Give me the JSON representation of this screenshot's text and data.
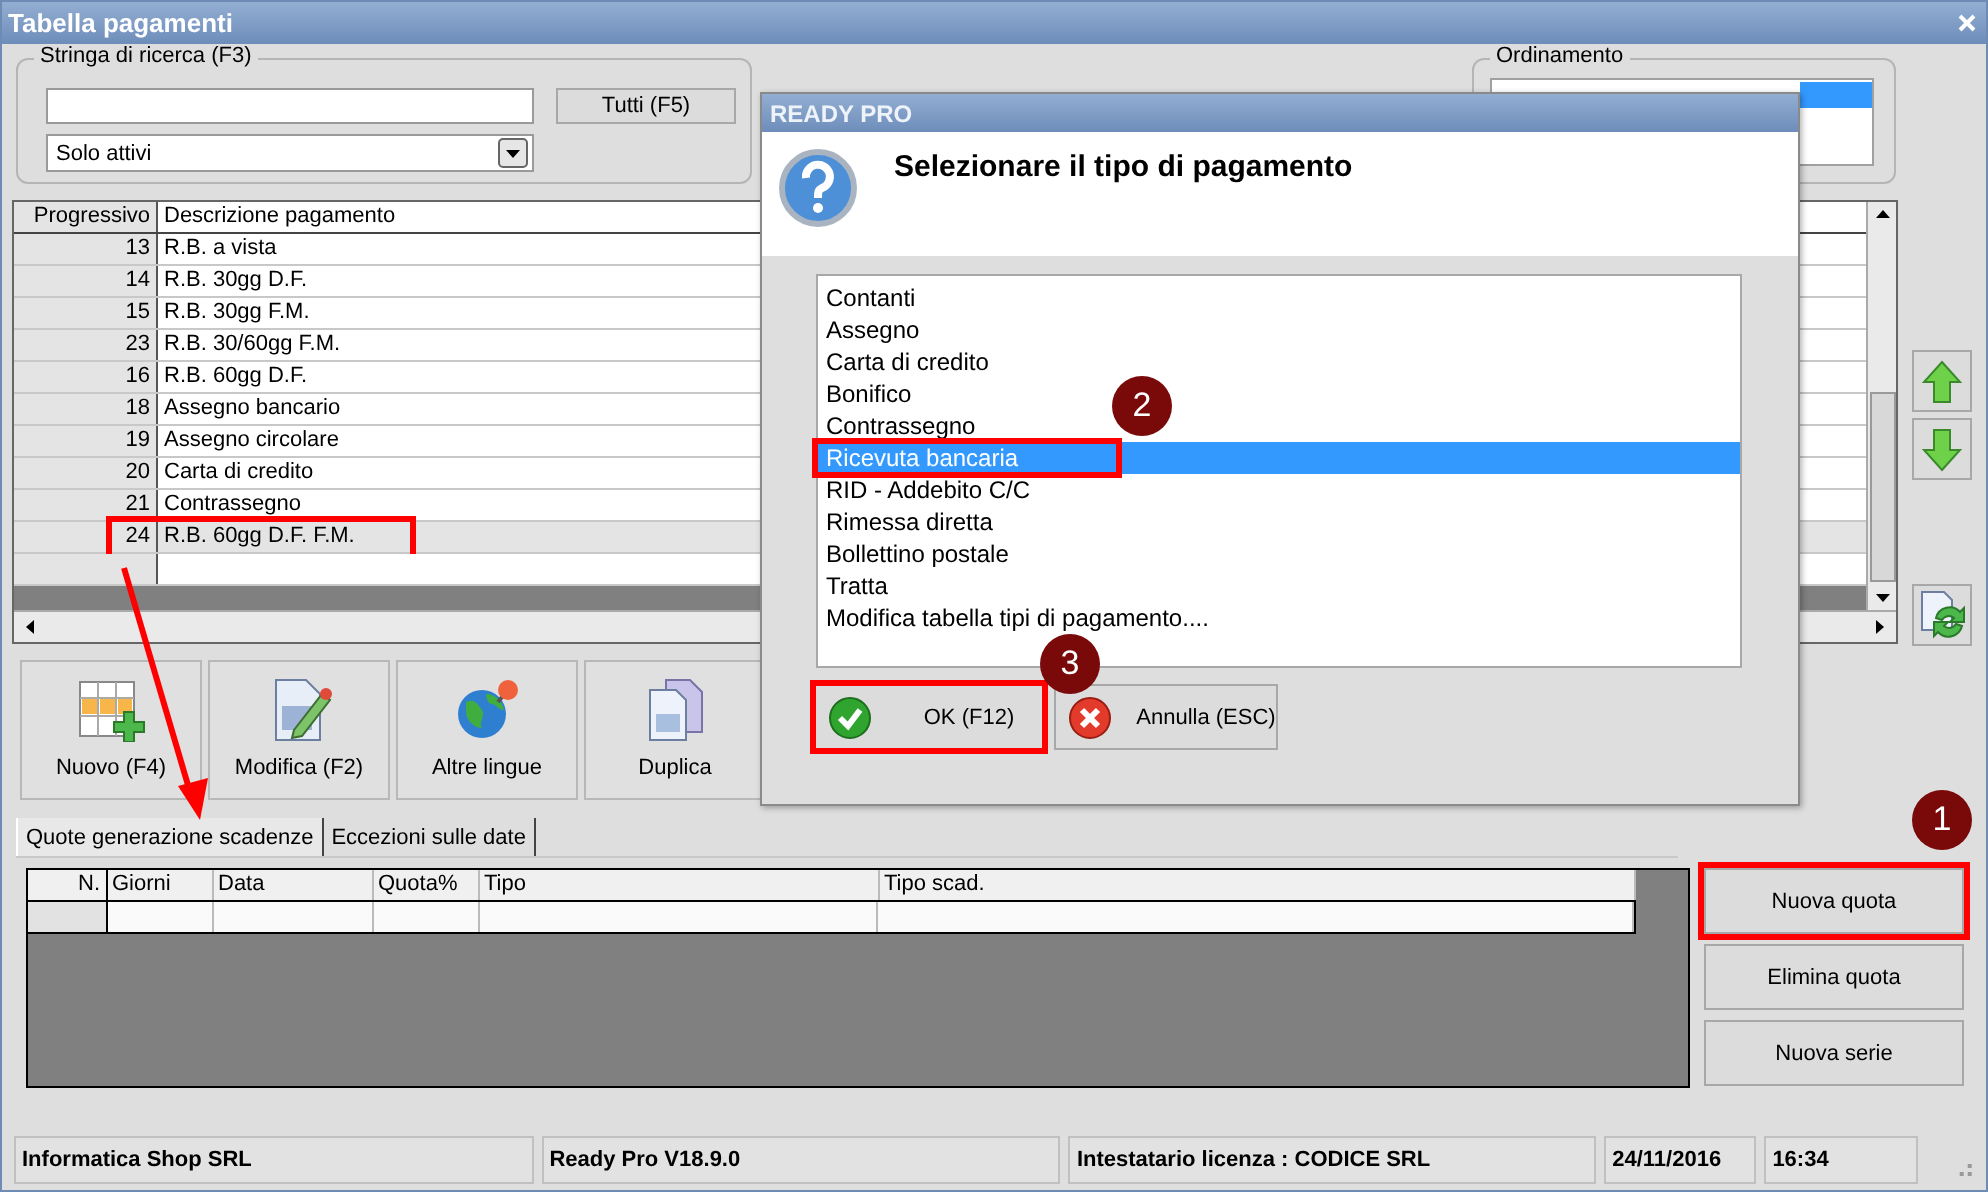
{
  "window": {
    "title": "Tabella pagamenti"
  },
  "search": {
    "legend": "Stringa di ricerca (F3)",
    "all_button": "Tutti (F5)",
    "filter": "Solo attivi"
  },
  "sort": {
    "legend": "Ordinamento"
  },
  "table": {
    "columns": [
      "Progressivo",
      "Descrizione pagamento"
    ],
    "rows": [
      {
        "progressivo": "13",
        "descrizione": "R.B. a vista",
        "selected": false,
        "highlighted": false
      },
      {
        "progressivo": "14",
        "descrizione": "R.B. 30gg D.F.",
        "selected": false,
        "highlighted": false
      },
      {
        "progressivo": "15",
        "descrizione": "R.B. 30gg F.M.",
        "selected": false,
        "highlighted": false
      },
      {
        "progressivo": "23",
        "descrizione": "R.B. 30/60gg F.M.",
        "selected": false,
        "highlighted": false
      },
      {
        "progressivo": "16",
        "descrizione": "R.B. 60gg D.F.",
        "selected": false,
        "highlighted": false
      },
      {
        "progressivo": "18",
        "descrizione": "Assegno bancario",
        "selected": false,
        "highlighted": false
      },
      {
        "progressivo": "19",
        "descrizione": "Assegno circolare",
        "selected": false,
        "highlighted": false
      },
      {
        "progressivo": "20",
        "descrizione": "Carta di credito",
        "selected": false,
        "highlighted": false
      },
      {
        "progressivo": "21",
        "descrizione": "Contrassegno",
        "selected": false,
        "highlighted": false
      },
      {
        "progressivo": "24",
        "descrizione": "R.B. 60gg D.F. F.M.",
        "selected": true,
        "highlighted": true
      }
    ]
  },
  "toolbar": [
    {
      "label": "Nuovo (F4)"
    },
    {
      "label": "Modifica (F2)"
    },
    {
      "label": "Altre lingue"
    },
    {
      "label": "Duplica"
    }
  ],
  "tabs": [
    {
      "label": "Quote generazione scadenze",
      "selected": true
    },
    {
      "label": "Eccezioni sulle date",
      "selected": false
    }
  ],
  "quota_table": {
    "columns": [
      "N.",
      "Giorni",
      "Data",
      "Quota%",
      "Tipo",
      "Tipo scad."
    ]
  },
  "side_buttons": [
    {
      "label": "Nuova quota",
      "highlighted": true
    },
    {
      "label": "Elimina quota",
      "highlighted": false
    },
    {
      "label": "Nuova serie",
      "highlighted": false
    }
  ],
  "status_bar": [
    "Informatica Shop SRL",
    "Ready Pro V18.9.0",
    "Intestatario licenza : CODICE SRL",
    "24/11/2016",
    "16:34"
  ],
  "dialog": {
    "title": "READY PRO",
    "prompt": "Selezionare il tipo di pagamento",
    "options": [
      {
        "label": "Contanti",
        "selected": false,
        "highlighted": false
      },
      {
        "label": "Assegno",
        "selected": false,
        "highlighted": false
      },
      {
        "label": "Carta di credito",
        "selected": false,
        "highlighted": false
      },
      {
        "label": "Bonifico",
        "selected": false,
        "highlighted": false
      },
      {
        "label": "Contrassegno",
        "selected": false,
        "highlighted": false
      },
      {
        "label": "Ricevuta bancaria",
        "selected": true,
        "highlighted": true
      },
      {
        "label": "RID - Addebito C/C",
        "selected": false,
        "highlighted": false
      },
      {
        "label": "Rimessa diretta",
        "selected": false,
        "highlighted": false
      },
      {
        "label": "Bollettino postale",
        "selected": false,
        "highlighted": false
      },
      {
        "label": "Tratta",
        "selected": false,
        "highlighted": false
      },
      {
        "label": "Modifica tabella tipi di pagamento....",
        "selected": false,
        "highlighted": false
      }
    ],
    "buttons": [
      {
        "label": "OK (F12)",
        "highlighted": true
      },
      {
        "label": "Annulla (ESC)",
        "highlighted": false
      }
    ]
  },
  "callouts": [
    {
      "label": "1"
    },
    {
      "label": "2"
    },
    {
      "label": "3"
    }
  ]
}
